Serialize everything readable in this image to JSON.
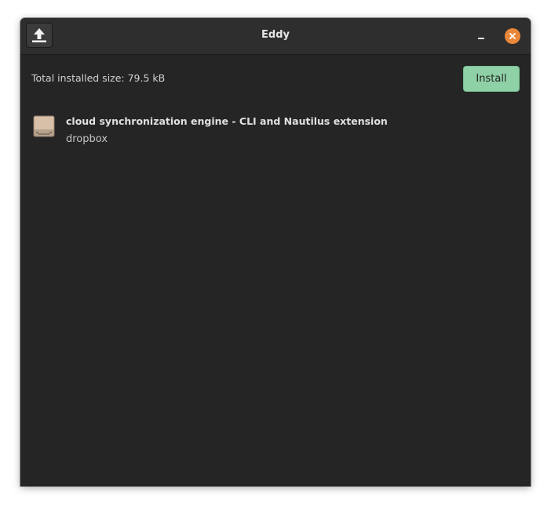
{
  "window": {
    "title": "Eddy",
    "icons": {
      "open": "upload-arrow-icon",
      "minimize": "minimize-icon",
      "close": "close-icon"
    },
    "colors": {
      "background": "#252525",
      "titlebar": "#2e2e2e",
      "close": "#e9873a",
      "install": "#8fd1a6"
    }
  },
  "summary": {
    "total_size_text": "Total installed size: 79.5 kB"
  },
  "actions": {
    "install_label": "Install"
  },
  "packages": [
    {
      "description": "cloud synchronization engine - CLI and Nautilus extension",
      "name": "dropbox",
      "icon": "package-icon"
    }
  ]
}
